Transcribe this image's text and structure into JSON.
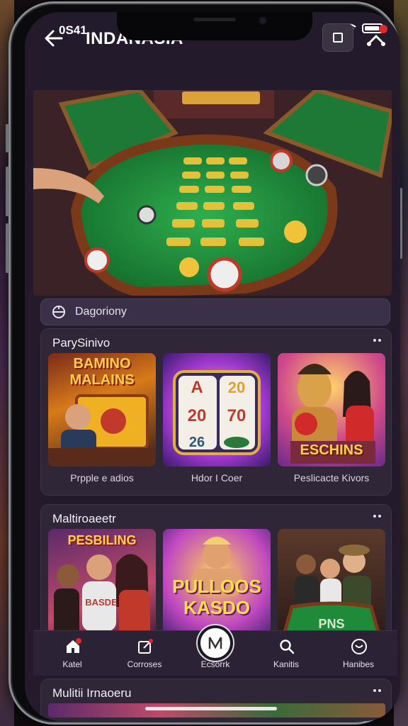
{
  "status_bar": {
    "time": "0S41"
  },
  "app_bar": {
    "title": "INDANASIA"
  },
  "category": {
    "label": "Dagoriony"
  },
  "sections": [
    {
      "title": "ParySinivo",
      "cards": [
        {
          "art_text": "BAMINO MALAINS",
          "art_sub": "",
          "caption": "Prpple e adios"
        },
        {
          "art_text": "A 20 20 70 26",
          "caption": "Hdor I Coer"
        },
        {
          "art_text": "ESCHINS",
          "caption": "Peslicacte Kivors"
        }
      ]
    },
    {
      "title": "Maltiroaeetr",
      "cards": [
        {
          "art_text": "PESBILING",
          "art_sub": "BASDE",
          "caption": ""
        },
        {
          "art_text": "PULLOOS KASDO",
          "caption": ""
        },
        {
          "art_text": "PNS",
          "caption": ""
        }
      ]
    },
    {
      "title": "Mulitii Irnaoeru",
      "cards": []
    }
  ],
  "bottom_nav": [
    {
      "label": "Katel",
      "icon": "home-icon"
    },
    {
      "label": "Corroses",
      "icon": "edit-icon"
    },
    {
      "label": "Ecsorrk",
      "icon": "center-logo-icon"
    },
    {
      "label": "Kanitis",
      "icon": "search-icon"
    },
    {
      "label": "Hanibes",
      "icon": "profile-icon"
    }
  ],
  "colors": {
    "accent_red": "#e02a2a",
    "panel": "#2f2638",
    "felt_green": "#1f8a3a"
  }
}
